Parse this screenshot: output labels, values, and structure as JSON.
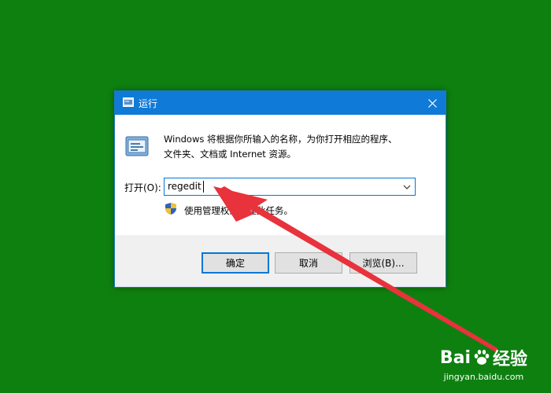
{
  "dialog": {
    "title": "运行",
    "description_line1": "Windows 将根据你所输入的名称，为你打开相应的程序、",
    "description_line2": "文件夹、文档或 Internet 资源。",
    "open_label": "打开(O):",
    "command_value": "regedit",
    "admin_notice": "使用管理权限创建此任务。",
    "buttons": {
      "ok": "确定",
      "cancel": "取消",
      "browse": "浏览(B)..."
    }
  },
  "watermark": {
    "logo_left": "Bai",
    "logo_right": "经验",
    "url": "jingyan.baidu.com"
  },
  "colors": {
    "desktop": "#0e8010",
    "titlebar": "#0f7ad8",
    "accent": "#0078d7",
    "arrow": "#e8323c"
  }
}
